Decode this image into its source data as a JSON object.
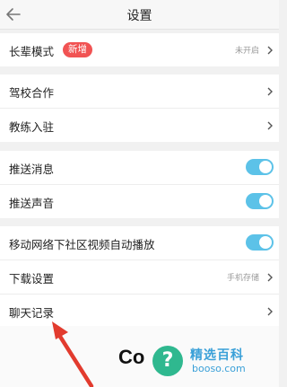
{
  "header": {
    "title": "设置",
    "back_icon": "back-arrow-icon"
  },
  "groups": {
    "g1": {
      "elder_mode": {
        "label": "长辈模式",
        "badge": "新增",
        "status": "未开启"
      }
    },
    "g2": {
      "driving_school": {
        "label": "驾校合作"
      },
      "coach_join": {
        "label": "教练入驻"
      }
    },
    "g3": {
      "push_message": {
        "label": "推送消息",
        "enabled": true
      },
      "push_sound": {
        "label": "推送声音",
        "enabled": true
      }
    },
    "g4": {
      "autoplay": {
        "label": "移动网络下社区视频自动播放",
        "enabled": true
      },
      "download": {
        "label": "下载设置",
        "value": "手机存储"
      },
      "chat_history": {
        "label": "聊天记录"
      }
    }
  },
  "bottom": {
    "partial_text": "Co"
  },
  "watermark": {
    "title": "精选百科",
    "url": "booso.com",
    "icon": "question-mark-icon"
  },
  "colors": {
    "badge": "#f15353",
    "toggle_on": "#5cc2e8",
    "annotation_arrow": "#e23b2e",
    "watermark": "#3aa0d8"
  }
}
